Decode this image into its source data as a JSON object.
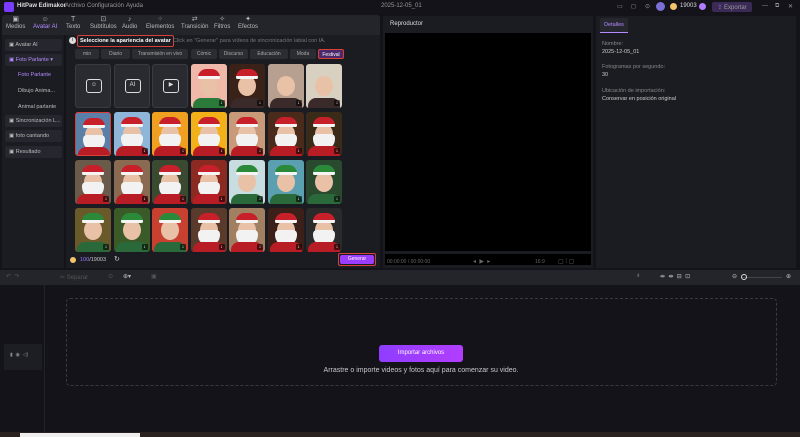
{
  "app": {
    "name": "HitPaw Edimakor",
    "menu": [
      "Archivo",
      "Configuración",
      "Ayuda"
    ],
    "project": "2025-12-05_01",
    "coins": "19003",
    "export": "Exportar"
  },
  "toolbar": [
    {
      "label": "Medios",
      "icon": "▣"
    },
    {
      "label": "Avatar AI",
      "icon": "☺"
    },
    {
      "label": "Texto",
      "icon": "T"
    },
    {
      "label": "Subtítulos",
      "icon": "⊡"
    },
    {
      "label": "Audio",
      "icon": "♪"
    },
    {
      "label": "Elementos",
      "icon": "⁘"
    },
    {
      "label": "Transición",
      "icon": "⇄"
    },
    {
      "label": "Filtros",
      "icon": "✧"
    },
    {
      "label": "Efectos",
      "icon": "✦"
    }
  ],
  "sidebar": [
    {
      "label": "Avatar AI"
    },
    {
      "label": "Foto Parlante"
    },
    {
      "label": "Foto Parlante"
    },
    {
      "label": "Dibujo Anima..."
    },
    {
      "label": "Animal parlante"
    },
    {
      "label": "Sincronización L..."
    },
    {
      "label": "foto cantando"
    },
    {
      "label": "Resultado"
    }
  ],
  "main": {
    "heading": "Seleccione la apariencia del avatar",
    "hint": "Click en \"Generar\" para vídeos de sincronización labial con IA.",
    "categories": [
      "mio",
      "Diario",
      "Transmisión en vivo",
      "Cómic",
      "Discurso",
      "Educación",
      "Moda",
      "Festival"
    ],
    "credits_used": "100",
    "credits_total": "/19003",
    "generate": "Generar"
  },
  "player": {
    "title": "Reproductor",
    "time": "00:00:00",
    "duration": "/ 00:00:00",
    "ratio": "16:9"
  },
  "details": {
    "tab": "Detalles",
    "name_label": "Nombre:",
    "name": "2025-12-05_01",
    "fps_label": "Fotogramas por segundo:",
    "fps": "30",
    "import_label": "Ubicación de importación:",
    "import": "Conservar en posición original"
  },
  "timeline": {
    "separate": "Separar",
    "import_button": "Importar archivos",
    "drop_hint": "Arrastre o importe videos y fotos aquí para comenzar su video."
  },
  "colors": {
    "accent": "#9b4dff",
    "highlight": "#d9403a"
  }
}
